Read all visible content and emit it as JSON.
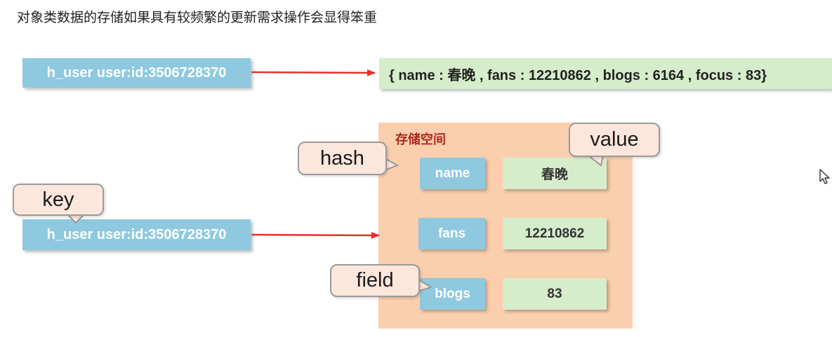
{
  "heading": "对象类数据的存储如果具有较频繁的更新需求操作会显得笨重",
  "top_row": {
    "key": "h_user user:id:3506728370",
    "value": "{ name : 春晚 , fans : 12210862 , blogs : 6164 , focus : 83}"
  },
  "hash_row": {
    "key": "h_user user:id:3506728370",
    "storage_label": "存储空间",
    "fields": [
      {
        "field": "name",
        "value": "春晚"
      },
      {
        "field": "fans",
        "value": "12210862"
      },
      {
        "field": "blogs",
        "value": "83"
      }
    ]
  },
  "callouts": {
    "hash": "hash",
    "value": "value",
    "key": "key",
    "field": "field"
  },
  "colors": {
    "key_box": "#8ec9e0",
    "value_box": "#d6edcb",
    "storage": "#fbcfad",
    "arrow": "#e8302a",
    "storage_title": "#b0281e"
  }
}
